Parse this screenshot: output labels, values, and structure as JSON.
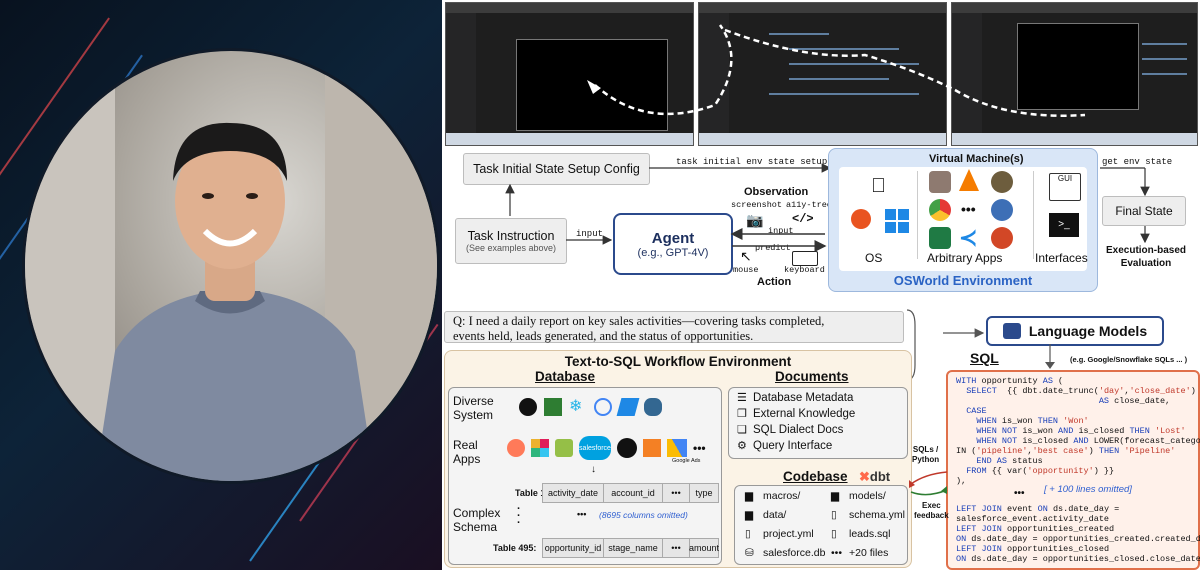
{
  "top_flow": {
    "setup_config": "Task Initial State Setup Config",
    "setup_arrow_label": "task initial env state setup",
    "task_instruction": "Task Instruction",
    "task_instruction_sub": "(See examples above)",
    "input_label": "input",
    "agent": "Agent",
    "agent_sub": "(e.g., GPT-4V)",
    "observation": "Observation",
    "screenshot": "screenshot",
    "a11y_tree": "a11y-tree",
    "obs_input": "input",
    "predict": "predict",
    "mouse": "mouse",
    "keyboard": "keyboard",
    "action": "Action",
    "vm_title": "Virtual Machine(s)",
    "os": "OS",
    "apps": "Arbitrary Apps",
    "interfaces": "Interfaces",
    "env_title": "OSWorld Environment",
    "get_env_state": "get env state",
    "final_state": "Final State",
    "eval": "Execution-based",
    "eval2": "Evaluation"
  },
  "question": {
    "line1": "Q: I need a daily report on key sales activities—covering tasks completed,",
    "line2": "events held, leads generated, and the status of opportunities."
  },
  "workflow": {
    "title": "Text-to-SQL Workflow Environment",
    "database": "Database",
    "documents": "Documents",
    "diverse": "Diverse",
    "system": "System",
    "real": "Real",
    "apps": "Apps",
    "complex": "Complex",
    "schema": "Schema",
    "salesforce": "salesforce",
    "google_ads": "Google Ads",
    "table1": "Table 1:",
    "t1_cols": [
      "activity_date",
      "account_id",
      "•••",
      "type"
    ],
    "omitted": "(8695 columns omitted)",
    "table495": "Table 495:",
    "t495_cols": [
      "opportunity_id",
      "stage_name",
      "•••",
      "amount"
    ],
    "dots": "•••",
    "docs": [
      "Database Metadata",
      "External Knowledge",
      "SQL Dialect Docs",
      "Query Interface"
    ],
    "codebase": "Codebase",
    "dbt": "dbt",
    "files_left": [
      "macros/",
      "data/",
      "project.yml",
      "salesforce.db"
    ],
    "files_right": [
      "models/",
      "schema.yml",
      "leads.sql",
      "+20 files"
    ]
  },
  "right_panel": {
    "lm": "Language Models",
    "sql": "SQL",
    "sql_note": "(e.g. Google/Snowflake SQLs ... )",
    "sqls_python": "SQLs /",
    "python": "Python",
    "exec": "Exec",
    "feedback": "feedback",
    "omitted": "[ + 100 lines omitted]",
    "dots": "•••"
  }
}
